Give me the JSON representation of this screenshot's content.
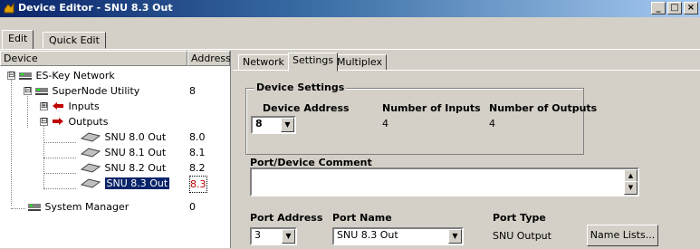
{
  "window": {
    "title": "Device Editor - SNU 8.3 Out",
    "controls": [
      "_",
      "□",
      "×"
    ]
  },
  "top_tabs": [
    "Edit",
    "Quick Edit"
  ],
  "tree": {
    "col_device": "Device",
    "col_address": "Address",
    "items": [
      {
        "label": "ES-Key Network",
        "address": ""
      },
      {
        "label": "SuperNode Utility",
        "address": "8"
      },
      {
        "label": "Inputs",
        "address": ""
      },
      {
        "label": "Outputs",
        "address": ""
      },
      {
        "label": "SNU 8.0 Out",
        "address": "8.0"
      },
      {
        "label": "SNU 8.1 Out",
        "address": "8.1"
      },
      {
        "label": "SNU 8.2 Out",
        "address": "8.2"
      },
      {
        "label": "SNU 8.3 Out",
        "address": "8.3"
      },
      {
        "label": "System Manager",
        "address": "0"
      }
    ],
    "expanders": [
      "⊟",
      "⊟",
      "⊞",
      "⊟"
    ]
  },
  "right_tabs": [
    "Network",
    "Settings",
    "Multiplex"
  ],
  "device_settings": {
    "group_label": "Device Settings",
    "address_label": "Device Address",
    "address_value": "8",
    "inputs_label": "Number of Inputs",
    "inputs_value": "4",
    "outputs_label": "Number of Outputs",
    "outputs_value": "4"
  },
  "comment": {
    "label": "Port/Device Comment",
    "value": ""
  },
  "port": {
    "address_label": "Port Address",
    "address_value": "3",
    "name_label": "Port Name",
    "name_value": "SNU 8.3 Out",
    "type_label": "Port Type",
    "type_value": "SNU Output",
    "name_lists_button": "Name Lists..."
  },
  "colors": {
    "title_start": "#0a246a",
    "title_end": "#a6caf0",
    "selected_bg": "#0a246a",
    "selected_address": "#c00000",
    "input_arrow": "#c00000",
    "output_arrow": "#c00000"
  }
}
